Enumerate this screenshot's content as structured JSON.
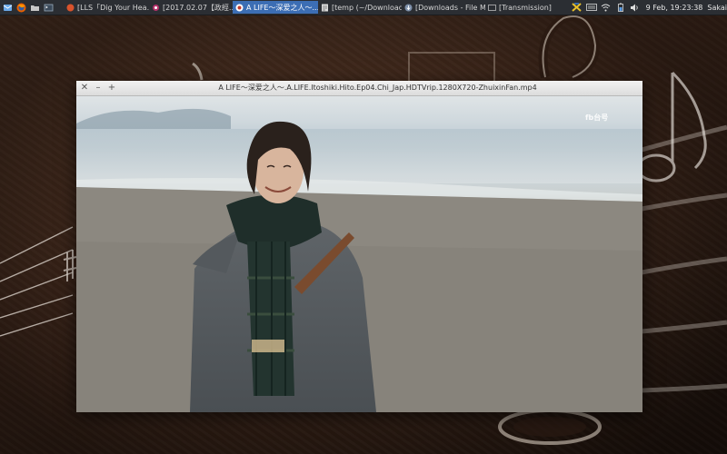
{
  "panel": {
    "launchers": [
      {
        "icon": "mail-icon"
      },
      {
        "icon": "firefox-icon"
      },
      {
        "icon": "folder-icon"
      },
      {
        "icon": "terminal-icon"
      }
    ],
    "tasks": [
      {
        "label": "[LLS「Dig Your Hea...",
        "icon": "browser-tab-icon",
        "active": false
      },
      {
        "label": "[2017.02.07【政經...",
        "icon": "media-icon",
        "active": false
      },
      {
        "label": "A LIFE〜深爱之人〜...",
        "icon": "video-player-icon",
        "active": true
      },
      {
        "label": "[temp (~/Download...",
        "icon": "text-editor-icon",
        "active": false
      },
      {
        "label": "[Downloads - File M...",
        "icon": "file-manager-icon",
        "active": false
      },
      {
        "label": "[Transmission]",
        "icon": "transmission-icon",
        "active": false
      }
    ],
    "tray": {
      "icons": [
        "xfce-icon",
        "keyboard-icon",
        "wifi-icon",
        "battery-icon",
        "volume-icon"
      ],
      "clock": "9 Feb, 19:23:38",
      "user": "Sakai"
    }
  },
  "window": {
    "title": "A LIFE～深爱之人～.A.LIFE.Itoshiki.Hito.Ep04.Chi_Jap.HDTVrip.1280X720-ZhuixinFan.mp4",
    "watermark": "fb台号"
  },
  "colors": {
    "panel_bg": "#2b2e33",
    "active_task": "#3c6eb4",
    "wallpaper": "#5a3826"
  }
}
